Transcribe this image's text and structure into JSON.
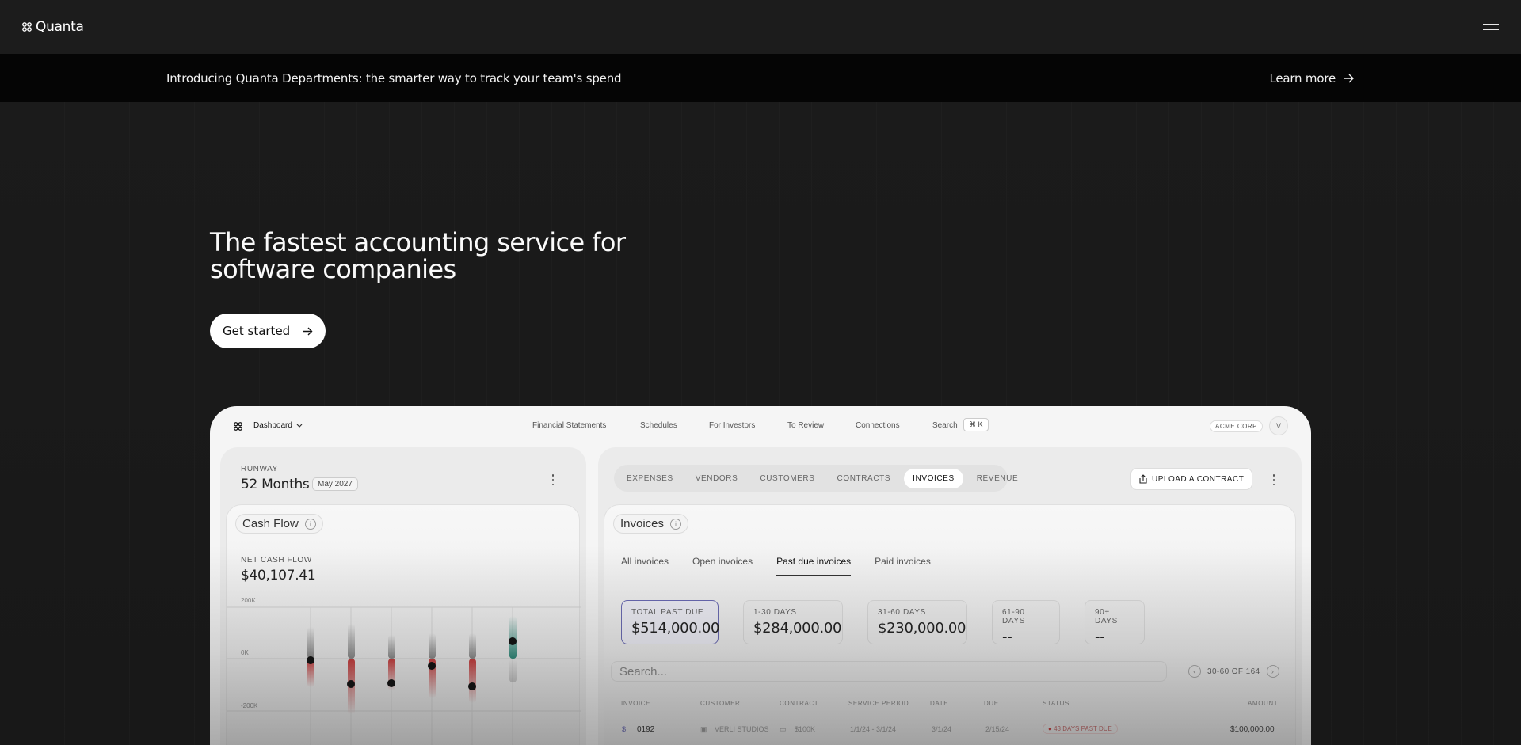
{
  "brand": {
    "name": "Quanta"
  },
  "banner": {
    "text": "Introducing Quanta Departments: the smarter way to track your team's spend",
    "link": "Learn more"
  },
  "hero": {
    "title": "The fastest accounting service for software companies",
    "cta": "Get started"
  },
  "app": {
    "dashboard_label": "Dashboard",
    "nav": [
      "Financial Statements",
      "Schedules",
      "For Investors",
      "To Review",
      "Connections"
    ],
    "search_label": "Search",
    "search_kbd": "⌘ K",
    "company": "ACME CORP",
    "avatar": "V",
    "runway": {
      "label": "RUNWAY",
      "value": "52 Months",
      "date": "May 2027"
    },
    "cashflow": {
      "title": "Cash Flow",
      "metric_label": "NET CASH FLOW",
      "metric_value": "$40,107.41",
      "y_labels": [
        "200K",
        "0K",
        "-200K"
      ]
    },
    "tabs": [
      "EXPENSES",
      "VENDORS",
      "CUSTOMERS",
      "CONTRACTS",
      "INVOICES",
      "REVENUE"
    ],
    "active_tab": "INVOICES",
    "upload": "UPLOAD A CONTRACT",
    "invoices": {
      "title": "Invoices",
      "subtabs": [
        "All invoices",
        "Open invoices",
        "Past due invoices",
        "Paid invoices"
      ],
      "active_subtab": "Past due invoices",
      "cards": [
        {
          "label": "TOTAL PAST DUE",
          "value": "$514,000.00"
        },
        {
          "label": "1-30 DAYS",
          "value": "$284,000.00"
        },
        {
          "label": "31-60 DAYS",
          "value": "$230,000.00"
        },
        {
          "label": "61-90 DAYS",
          "value": "--"
        },
        {
          "label": "90+ DAYS",
          "value": "--"
        }
      ],
      "search_placeholder": "Search...",
      "pager": "30-60 OF 164",
      "columns": [
        "INVOICE",
        "CUSTOMER",
        "CONTRACT",
        "SERVICE PERIOD",
        "DATE",
        "DUE",
        "STATUS",
        "AMOUNT"
      ],
      "row": {
        "invoice": "0192",
        "customer": "VERLI STUDIOS",
        "contract": "$100K",
        "period": "1/1/24 - 3/1/24",
        "date": "3/1/24",
        "due": "2/15/24",
        "status": "43 DAYS PAST DUE",
        "amount": "$100,000.00"
      }
    }
  },
  "colors": {
    "accent_red": "#c83a3a",
    "accent_teal": "#2e8a7a",
    "selected_border": "#6a6ab4"
  }
}
